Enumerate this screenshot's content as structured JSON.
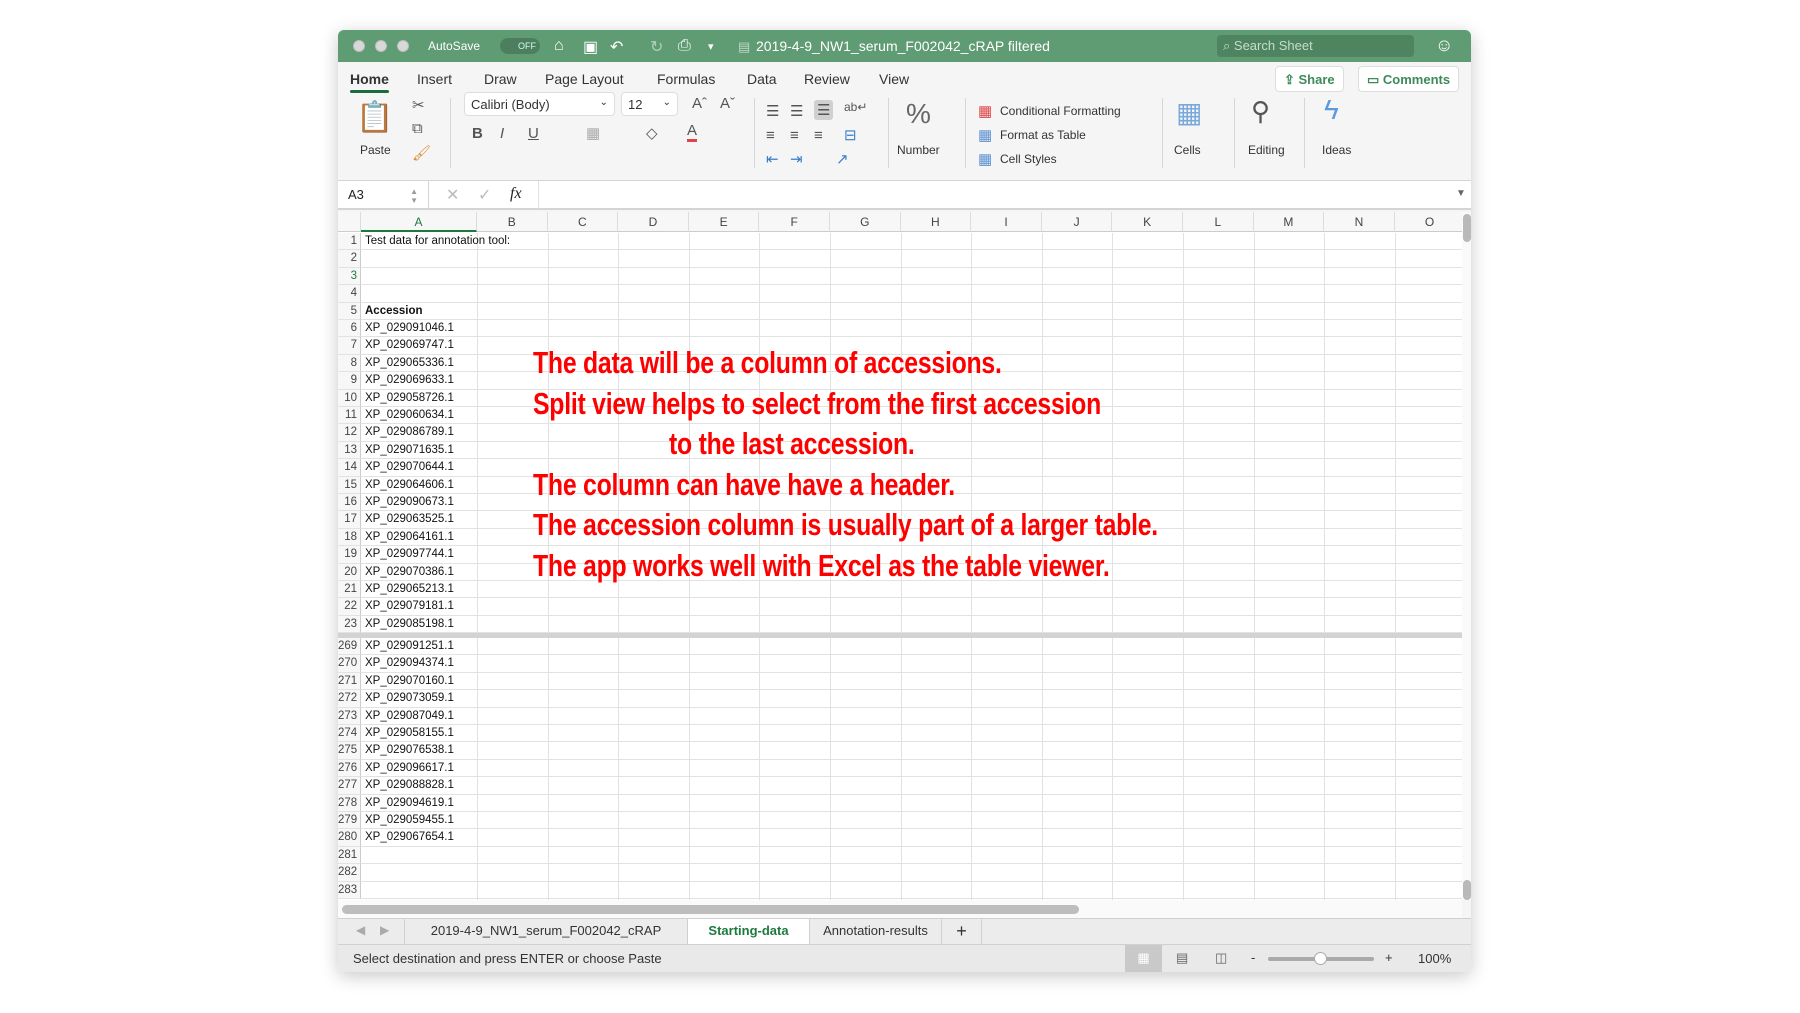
{
  "window": {
    "title": "2019-4-9_NW1_serum_F002042_cRAP filtered",
    "autosave_label": "AutoSave",
    "autosave_state": "OFF",
    "search_placeholder": "Search Sheet"
  },
  "ribbon": {
    "tabs": [
      {
        "label": "Home",
        "active": true
      },
      {
        "label": "Insert"
      },
      {
        "label": "Draw"
      },
      {
        "label": "Page Layout"
      },
      {
        "label": "Formulas"
      },
      {
        "label": "Data"
      },
      {
        "label": "Review"
      },
      {
        "label": "View"
      }
    ],
    "share_label": "Share",
    "comments_label": "Comments",
    "paste_label": "Paste",
    "font_name": "Calibri (Body)",
    "font_size": "12",
    "bold": "B",
    "italic": "I",
    "underline": "U",
    "number_label": "Number",
    "conditional_formatting": "Conditional Formatting",
    "format_as_table": "Format as Table",
    "cell_styles": "Cell Styles",
    "cells_label": "Cells",
    "editing_label": "Editing",
    "ideas_label": "Ideas"
  },
  "formula_bar": {
    "name_box": "A3",
    "fx": "fx",
    "value": ""
  },
  "grid": {
    "columns": [
      "A",
      "B",
      "C",
      "D",
      "E",
      "F",
      "G",
      "H",
      "I",
      "J",
      "K",
      "L",
      "M",
      "N",
      "O"
    ],
    "active_column": "A",
    "active_row": 3,
    "top_pane": [
      {
        "row": 1,
        "A": "Test data for annotation tool:"
      },
      {
        "row": 2,
        "A": ""
      },
      {
        "row": 3,
        "A": ""
      },
      {
        "row": 4,
        "A": ""
      },
      {
        "row": 5,
        "A": "Accession",
        "bold": true
      },
      {
        "row": 6,
        "A": "XP_029091046.1"
      },
      {
        "row": 7,
        "A": "XP_029069747.1"
      },
      {
        "row": 8,
        "A": "XP_029065336.1"
      },
      {
        "row": 9,
        "A": "XP_029069633.1"
      },
      {
        "row": 10,
        "A": "XP_029058726.1"
      },
      {
        "row": 11,
        "A": "XP_029060634.1"
      },
      {
        "row": 12,
        "A": "XP_029086789.1"
      },
      {
        "row": 13,
        "A": "XP_029071635.1"
      },
      {
        "row": 14,
        "A": "XP_029070644.1"
      },
      {
        "row": 15,
        "A": "XP_029064606.1"
      },
      {
        "row": 16,
        "A": "XP_029090673.1"
      },
      {
        "row": 17,
        "A": "XP_029063525.1"
      },
      {
        "row": 18,
        "A": "XP_029064161.1"
      },
      {
        "row": 19,
        "A": "XP_029097744.1"
      },
      {
        "row": 20,
        "A": "XP_029070386.1"
      },
      {
        "row": 21,
        "A": "XP_029065213.1"
      },
      {
        "row": 22,
        "A": "XP_029079181.1"
      },
      {
        "row": 23,
        "A": "XP_029085198.1"
      }
    ],
    "bottom_pane": [
      {
        "row": 269,
        "A": "XP_029091251.1"
      },
      {
        "row": 270,
        "A": "XP_029094374.1"
      },
      {
        "row": 271,
        "A": "XP_029070160.1"
      },
      {
        "row": 272,
        "A": "XP_029073059.1"
      },
      {
        "row": 273,
        "A": "XP_029087049.1"
      },
      {
        "row": 274,
        "A": "XP_029058155.1"
      },
      {
        "row": 275,
        "A": "XP_029076538.1"
      },
      {
        "row": 276,
        "A": "XP_029096617.1"
      },
      {
        "row": 277,
        "A": "XP_029088828.1"
      },
      {
        "row": 278,
        "A": "XP_029094619.1"
      },
      {
        "row": 279,
        "A": "XP_029059455.1"
      },
      {
        "row": 280,
        "A": "XP_029067654.1"
      },
      {
        "row": 281,
        "A": ""
      },
      {
        "row": 282,
        "A": ""
      },
      {
        "row": 283,
        "A": ""
      }
    ]
  },
  "annotation": {
    "color": "#ff0000",
    "lines": [
      "The data will be a column of accessions.",
      "Split view helps to select from the first accession",
      "to the last accession.",
      "The column can have have a header.",
      "The accession column is usually part of a larger table.",
      "The app works well with Excel as the table viewer."
    ]
  },
  "sheet_tabs": [
    {
      "label": "2019-4-9_NW1_serum_F002042_cRAP"
    },
    {
      "label": "Starting-data",
      "active": true
    },
    {
      "label": "Annotation-results"
    }
  ],
  "add_sheet": "+",
  "status": {
    "message": "Select destination and press ENTER or choose Paste",
    "zoom": "100%",
    "zoom_minus": "-",
    "zoom_plus": "+",
    "zoom_fraction": 0.5
  },
  "colors": {
    "titlebar": "#5f9b73",
    "accent": "#1d7a3e",
    "annotation": "#ff0000"
  }
}
